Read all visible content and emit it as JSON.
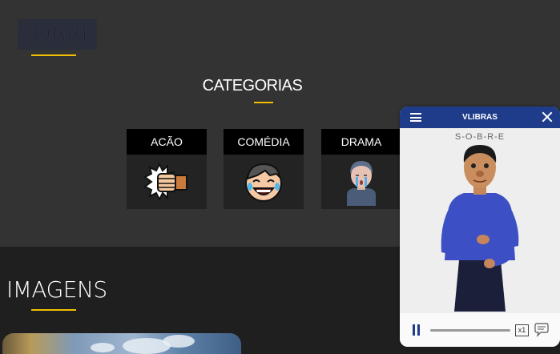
{
  "sobre": {
    "title": "SOBRE"
  },
  "categorias": {
    "title": "CATEGORIAS",
    "items": [
      {
        "label": "ACÃO",
        "icon": "punch-fist-icon"
      },
      {
        "label": "COMÉDIA",
        "icon": "laughing-face-icon"
      },
      {
        "label": "DRAMA",
        "icon": "crying-person-icon"
      }
    ]
  },
  "imagens": {
    "title": "IMAGENS"
  },
  "vlibras": {
    "title": "VLIBRAS",
    "subtitle": "S-O-B-R-E",
    "speed": "x1",
    "icons": [
      "menu-icon",
      "close-icon",
      "pause-icon",
      "speed-icon",
      "subtitles-bubble-icon"
    ]
  },
  "colors": {
    "accent": "#f0c000",
    "vlibras_blue": "#1f3c8a"
  }
}
